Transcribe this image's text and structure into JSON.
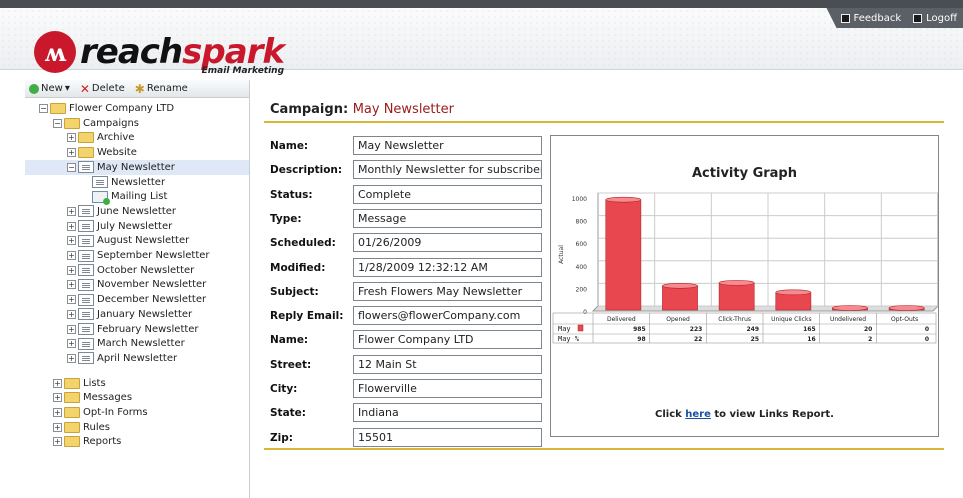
{
  "toplinks": {
    "feedback": "Feedback",
    "logoff": "Logoff"
  },
  "logo": {
    "part1": "reach",
    "part2": "spark",
    "tagline": "Email Marketing"
  },
  "toolbar": {
    "new": "New",
    "delete": "Delete",
    "rename": "Rename"
  },
  "tree": [
    {
      "label": "Flower Company LTD",
      "level": 0,
      "icon": "folder",
      "pm": "-"
    },
    {
      "label": "Campaigns",
      "level": 1,
      "icon": "folder",
      "pm": "-"
    },
    {
      "label": "Archive",
      "level": 2,
      "icon": "folder",
      "pm": "+"
    },
    {
      "label": "Website",
      "level": 2,
      "icon": "folder",
      "pm": "+"
    },
    {
      "label": "May Newsletter",
      "level": 2,
      "icon": "doc",
      "pm": "-",
      "selected": true
    },
    {
      "label": "Newsletter",
      "level": 3,
      "icon": "doc",
      "pm": ""
    },
    {
      "label": "Mailing List",
      "level": 3,
      "icon": "mail",
      "pm": ""
    },
    {
      "label": "June Newsletter",
      "level": 2,
      "icon": "doc",
      "pm": "+"
    },
    {
      "label": "July Newsletter",
      "level": 2,
      "icon": "doc",
      "pm": "+"
    },
    {
      "label": "August Newsletter",
      "level": 2,
      "icon": "doc",
      "pm": "+"
    },
    {
      "label": "September Newsletter",
      "level": 2,
      "icon": "doc",
      "pm": "+"
    },
    {
      "label": "October Newsletter",
      "level": 2,
      "icon": "doc",
      "pm": "+"
    },
    {
      "label": "November Newsletter",
      "level": 2,
      "icon": "doc",
      "pm": "+"
    },
    {
      "label": "December Newsletter",
      "level": 2,
      "icon": "doc",
      "pm": "+"
    },
    {
      "label": "January Newsletter",
      "level": 2,
      "icon": "doc",
      "pm": "+"
    },
    {
      "label": "February Newsletter",
      "level": 2,
      "icon": "doc",
      "pm": "+"
    },
    {
      "label": "March Newsletter",
      "level": 2,
      "icon": "doc",
      "pm": "+"
    },
    {
      "label": "April Newsletter",
      "level": 2,
      "icon": "doc",
      "pm": "+"
    },
    {
      "label": "Lists",
      "level": 1,
      "icon": "folder",
      "pm": "+",
      "gap": true
    },
    {
      "label": "Messages",
      "level": 1,
      "icon": "folder",
      "pm": "+"
    },
    {
      "label": "Opt-In Forms",
      "level": 1,
      "icon": "folder",
      "pm": "+"
    },
    {
      "label": "Rules",
      "level": 1,
      "icon": "folder",
      "pm": "+"
    },
    {
      "label": "Reports",
      "level": 1,
      "icon": "folder",
      "pm": "+"
    }
  ],
  "campaign": {
    "title_prefix": "Campaign:",
    "name": "May Newsletter"
  },
  "fields": [
    {
      "label": "Name:",
      "value": "May Newsletter"
    },
    {
      "label": "Description:",
      "value": "Monthly Newsletter for subscribers"
    },
    {
      "label": "Status:",
      "value": "Complete"
    },
    {
      "label": "Type:",
      "value": "Message"
    },
    {
      "label": "Scheduled:",
      "value": "01/26/2009"
    },
    {
      "label": "Modified:",
      "value": "1/28/2009 12:32:12 AM"
    },
    {
      "label": "Subject:",
      "value": "Fresh Flowers May Newsletter"
    },
    {
      "label": "Reply Email:",
      "value": "flowers@flowerCompany.com"
    },
    {
      "label": "Name:",
      "value": "Flower Company LTD"
    },
    {
      "label": "Street:",
      "value": "12 Main St"
    },
    {
      "label": "City:",
      "value": "Flowerville"
    },
    {
      "label": "State:",
      "value": "Indiana"
    },
    {
      "label": "Zip:",
      "value": "15501"
    }
  ],
  "graph_link": {
    "prefix": "Click ",
    "link": "here",
    "suffix": " to view Links Report."
  },
  "chart_data": {
    "type": "bar",
    "title": "Activity Graph",
    "ylabel": "Actual",
    "ylim": [
      0,
      1000
    ],
    "yticks": [
      0,
      200,
      400,
      600,
      800,
      1000
    ],
    "categories": [
      "Delivered",
      "Opened",
      "Click-Thrus",
      "Unique Clicks",
      "Undelivered",
      "Opt-Outs"
    ],
    "series": [
      {
        "name": "May",
        "values": [
          985,
          223,
          249,
          165,
          20,
          0
        ]
      }
    ],
    "table_rows": [
      {
        "label": "May",
        "values": [
          985,
          223,
          249,
          165,
          20,
          0
        ]
      },
      {
        "label": "May %",
        "values": [
          98,
          22,
          25,
          16,
          2,
          0
        ]
      }
    ],
    "bar_color": "#e8474f",
    "grid": true
  }
}
